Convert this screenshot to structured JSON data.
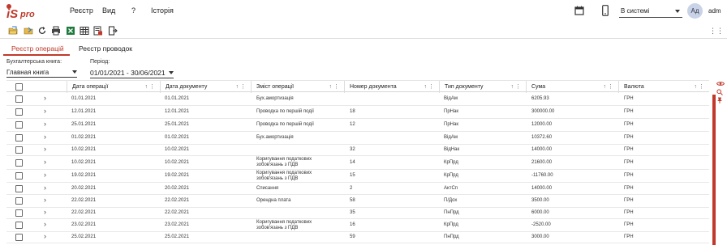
{
  "app": {
    "logo_text": "iS pro",
    "menu": [
      "Реєстр",
      "Вид",
      "?",
      "Історія"
    ],
    "status_value": "В системі",
    "avatar": "Ад",
    "user": "adm"
  },
  "icons": {
    "calendar": "calendar-icon",
    "phone": "mobile-icon",
    "toolbar": [
      "folder-open-icon",
      "folder-arrow-icon",
      "refresh-icon",
      "print-icon",
      "excel-export-icon",
      "grid-icon",
      "document-report-icon",
      "exit-icon"
    ]
  },
  "tabs": [
    "Реєстр операцій",
    "Реєстр проводок"
  ],
  "filters": {
    "book_label": "Бухгалтерська книга:",
    "book_value": "Главная книга",
    "period_label": "Період:",
    "period_value": "01/01/2021 - 30/06/2021"
  },
  "grid": {
    "columns": [
      "Дата операції",
      "Дата документу",
      "Зміст операції",
      "Номер документа",
      "Тип документу",
      "Сума",
      "Валюта"
    ],
    "rows": [
      [
        "01.01.2021",
        "01.01.2021",
        "Бух.амортизація",
        "",
        "ВідАм",
        "6205.93",
        "ГРН"
      ],
      [
        "12.01.2021",
        "12.01.2021",
        "Проводка по першій події",
        "18",
        "ПрНак",
        "300000.00",
        "ГРН"
      ],
      [
        "25.01.2021",
        "25.01.2021",
        "Проводка по першій події",
        "12",
        "ПрНак",
        "12000.00",
        "ГРН"
      ],
      [
        "01.02.2021",
        "01.02.2021",
        "Бух.амортизація",
        "",
        "ВідАм",
        "10372.60",
        "ГРН"
      ],
      [
        "10.02.2021",
        "10.02.2021",
        "",
        "32",
        "ВідНак",
        "14000.00",
        "ГРН"
      ],
      [
        "10.02.2021",
        "10.02.2021",
        "Коригування податкових зобов'язань з ПДВ",
        "14",
        "КрПрд",
        "21600.00",
        "ГРН"
      ],
      [
        "19.02.2021",
        "19.02.2021",
        "Коригування податкових зобов'язань з ПДВ",
        "15",
        "КрПрд",
        "-11760.00",
        "ГРН"
      ],
      [
        "20.02.2021",
        "20.02.2021",
        "Списання",
        "2",
        "АктСп",
        "14000.00",
        "ГРН"
      ],
      [
        "22.02.2021",
        "22.02.2021",
        "Орендна плата",
        "58",
        "П/Дох",
        "3500.00",
        "ГРН"
      ],
      [
        "22.02.2021",
        "22.02.2021",
        "",
        "35",
        "ПнПрд",
        "6000.00",
        "ГРН"
      ],
      [
        "23.02.2021",
        "23.02.2021",
        "Коригування податкових зобов'язань з ПДВ",
        "16",
        "КрПрд",
        "-2520.00",
        "ГРН"
      ],
      [
        "25.02.2021",
        "25.02.2021",
        "",
        "59",
        "ПнПрд",
        "3000.00",
        "ГРН"
      ]
    ]
  }
}
